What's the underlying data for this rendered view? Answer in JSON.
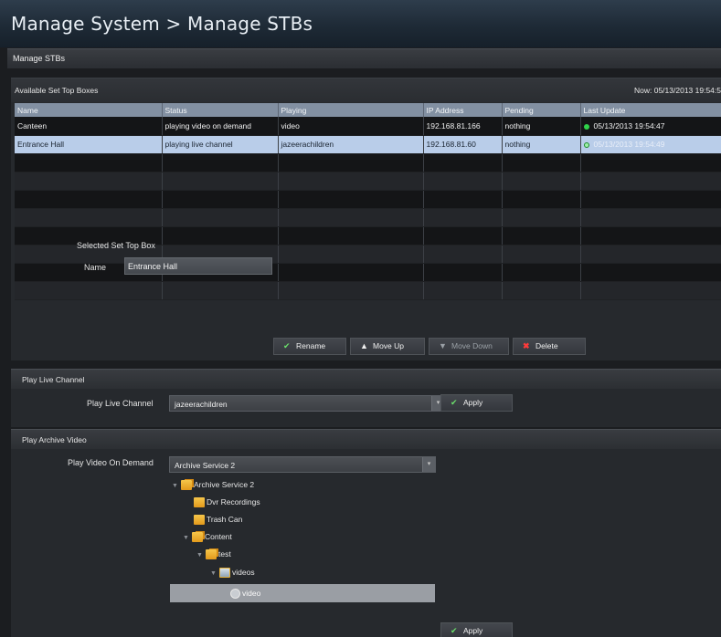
{
  "header": {
    "title": "Manage System  >  Manage STBs",
    "subtitle": "Manage STBs"
  },
  "stb_panel": {
    "title": "Available Set Top Boxes",
    "now": "Now: 05/13/2013 19:54:5",
    "columns": [
      "Name",
      "Status",
      "Playing",
      "IP Address",
      "Pending",
      "Last Update"
    ],
    "rows": [
      {
        "name": "Canteen",
        "status": "playing video on demand",
        "playing": "video",
        "ip": "192.168.81.166",
        "pending": "nothing",
        "last_update": "05/13/2013 19:54:47",
        "selected": false
      },
      {
        "name": "Entrance Hall",
        "status": "playing live channel",
        "playing": "jazeerachildren",
        "ip": "192.168.81.60",
        "pending": "nothing",
        "last_update": "05/13/2013 19:54:49",
        "selected": true
      }
    ],
    "selected_label": "Selected Set Top Box",
    "name_label": "Name",
    "name_value": "Entrance Hall",
    "buttons": {
      "rename": "Rename",
      "move_up": "Move Up",
      "move_down": "Move Down",
      "delete": "Delete"
    },
    "status_color": "#2fd24a"
  },
  "live_panel": {
    "title": "Play Live Channel",
    "field_label": "Play Live Channel",
    "selected": "jazeerachildren",
    "apply": "Apply"
  },
  "archive_panel": {
    "title": "Play Archive Video",
    "field_label": "Play Video On Demand",
    "selected": "Archive Service 2",
    "tree": {
      "root": "Archive Service 2",
      "dvr": "Dvr Recordings",
      "trash": "Trash Can",
      "content": "Content",
      "test": "test",
      "videos": "videos",
      "video": "video"
    },
    "apply": "Apply"
  }
}
